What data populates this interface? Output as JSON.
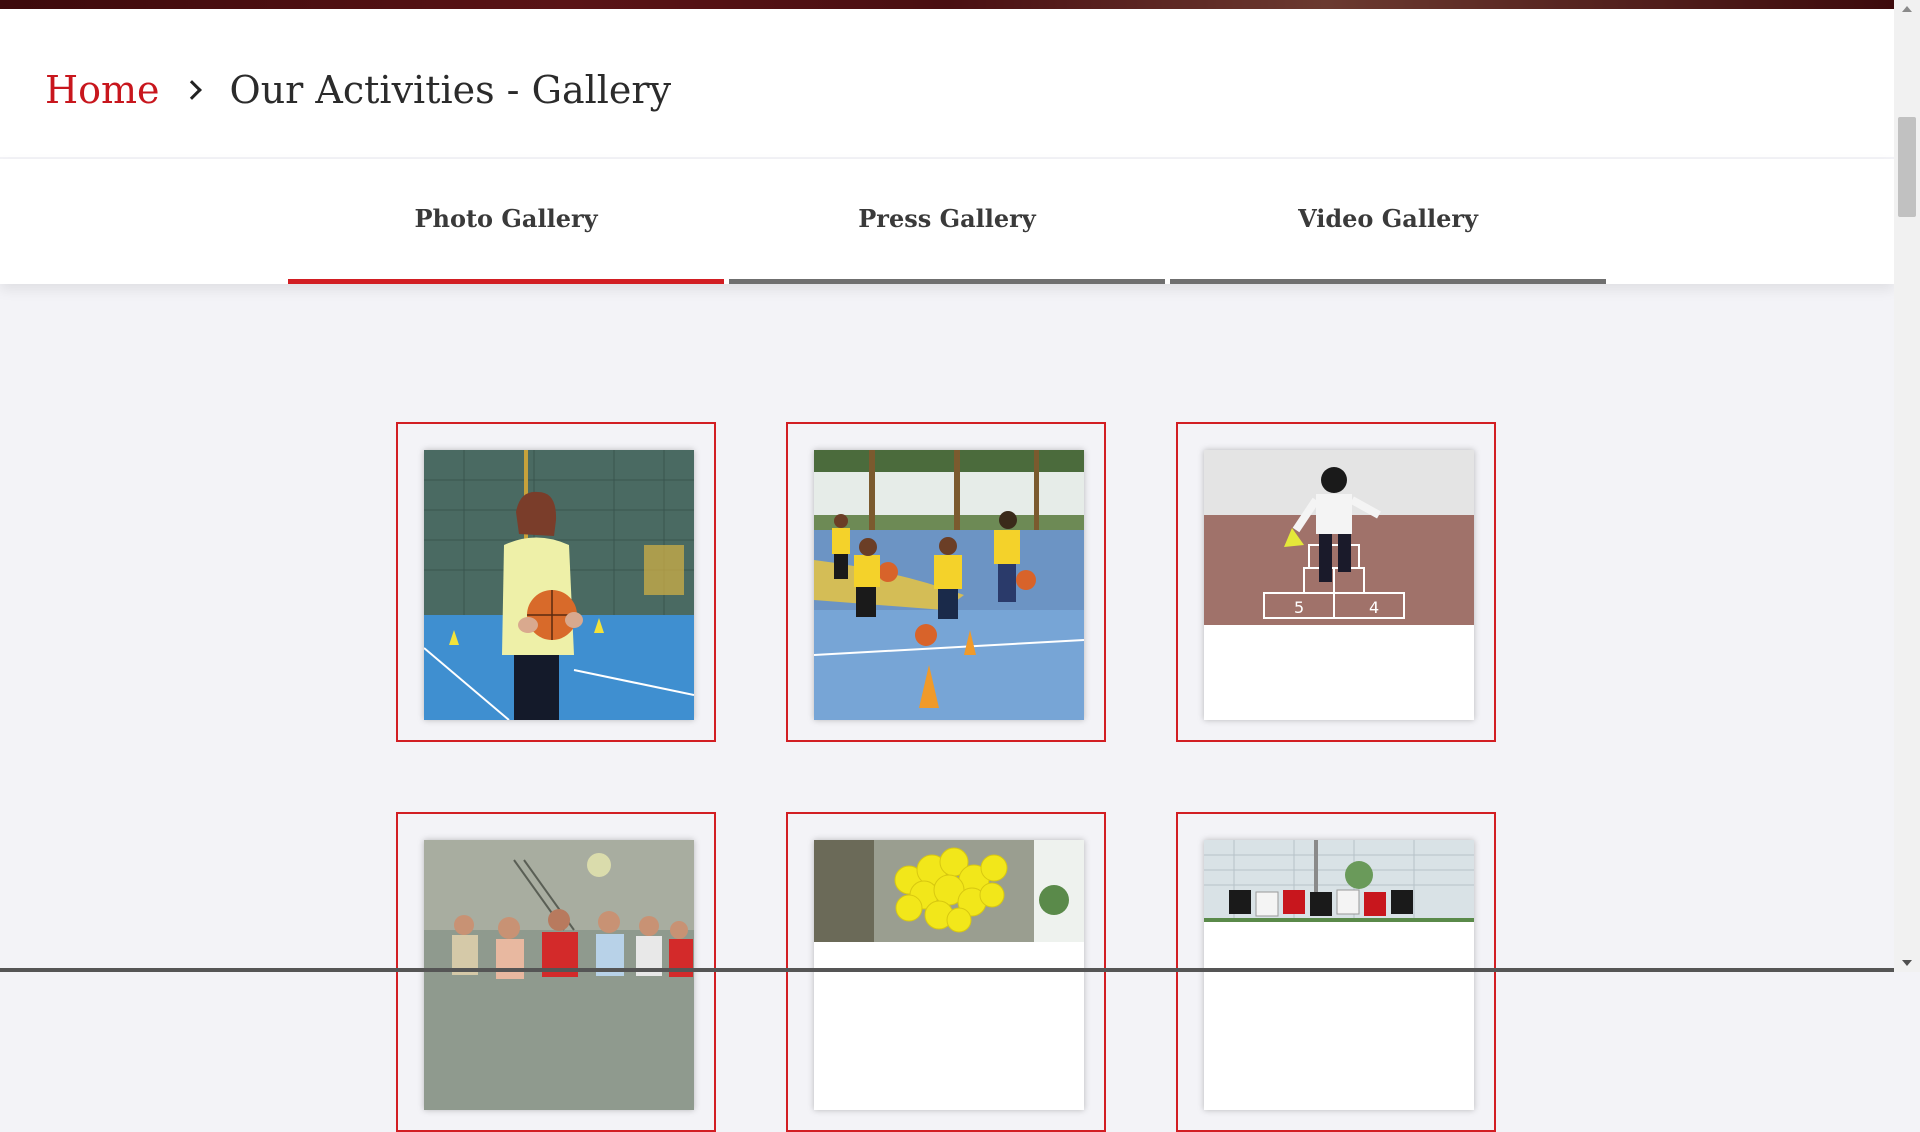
{
  "breadcrumb": {
    "home_label": "Home",
    "current_label": "Our Activities - Gallery"
  },
  "tabs": [
    {
      "label": "Photo Gallery",
      "active": true
    },
    {
      "label": "Press Gallery",
      "active": false
    },
    {
      "label": "Video Gallery",
      "active": false
    }
  ],
  "gallery": {
    "items": [
      {
        "subject": "woman holding basketball on blue court"
      },
      {
        "subject": "girls in yellow shirts dribbling basketballs"
      },
      {
        "subject": "child playing hopscotch"
      },
      {
        "subject": "group of people making heart gestures"
      },
      {
        "subject": "yellow smiley balloons"
      },
      {
        "subject": "court with red and black banners"
      }
    ]
  },
  "colors": {
    "accent": "#d21e23",
    "tab_inactive": "#6f6f6f",
    "page_bg": "#f3f3f7"
  }
}
